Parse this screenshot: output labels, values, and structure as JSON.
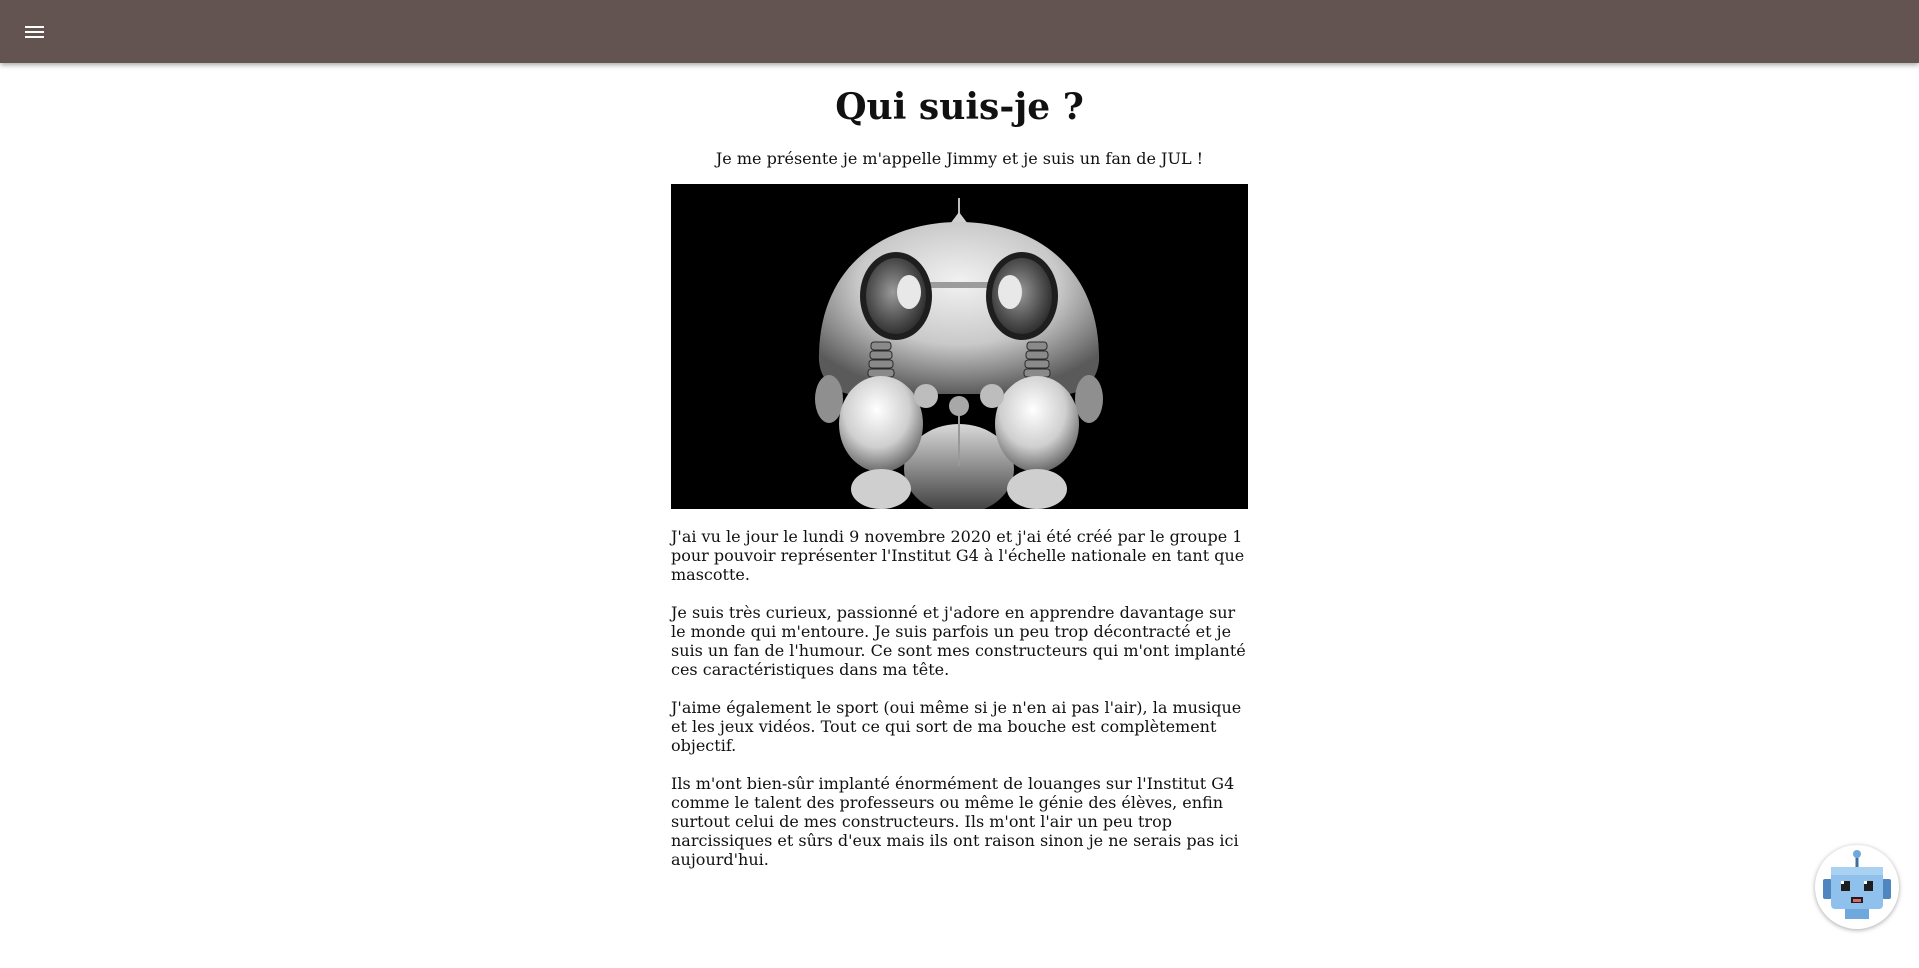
{
  "header": {
    "menu_icon": "hamburger-menu-icon",
    "background_color": "#635451"
  },
  "main": {
    "title": "Qui suis-je ?",
    "intro": "Je me présente je m'appelle Jimmy et je suis un fan de JUL !",
    "image_subject": "robot-mascot",
    "paragraphs": [
      "J'ai vu le jour le lundi 9 novembre 2020 et j'ai été créé par le groupe 1 pour pouvoir représenter l'Institut G4 à l'échelle nationale en tant que mascotte.",
      "Je suis très curieux, passionné et j'adore en apprendre davantage sur le monde qui m'entoure. Je suis parfois un peu trop décontracté et je suis un fan de l'humour. Ce sont mes constructeurs qui m'ont implanté ces caractéristiques dans ma tête.",
      "J'aime également le sport (oui même si je n'en ai pas l'air), la musique et les jeux vidéos. Tout ce qui sort de ma bouche est complètement objectif.",
      "Ils m'ont bien-sûr implanté énormément de louanges sur l'Institut G4 comme le talent des professeurs ou même le génie des élèves, enfin surtout celui de mes constructeurs. Ils m'ont l'air un peu trop narcissiques et sûrs d'eux mais ils ont raison sinon je ne serais pas ici aujourd'hui."
    ]
  },
  "chatbot": {
    "icon": "robot-chatbot-icon",
    "accent_color": "#6fa8dc"
  }
}
